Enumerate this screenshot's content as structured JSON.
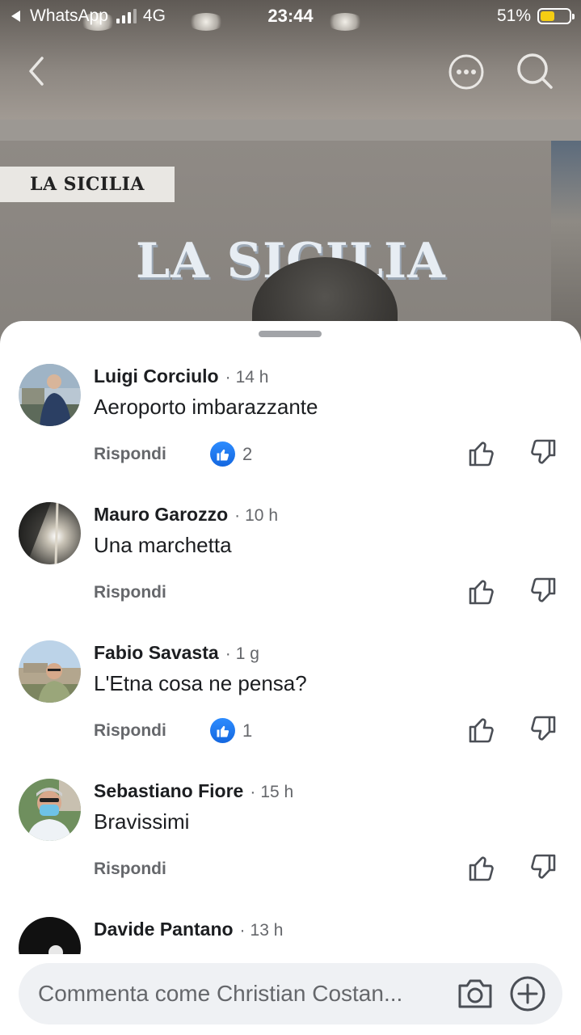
{
  "status_bar": {
    "back_app": "WhatsApp",
    "network": "4G",
    "time": "23:44",
    "battery_percent": "51%",
    "battery_level": 0.51,
    "battery_color": "#F4CD13"
  },
  "video": {
    "sign_small": "LA SICILIA",
    "sign_wall": "LA SICILIA"
  },
  "comments": [
    {
      "author": "Luigi Corciulo",
      "time": "14 h",
      "text": "Aeroporto imbarazzante",
      "reply_label": "Rispondi",
      "likes": "2"
    },
    {
      "author": "Mauro Garozzo",
      "time": "10 h",
      "text": "Una marchetta",
      "reply_label": "Rispondi",
      "likes": null
    },
    {
      "author": "Fabio Savasta",
      "time": "1 g",
      "text": "L'Etna cosa ne pensa?",
      "reply_label": "Rispondi",
      "likes": "1"
    },
    {
      "author": "Sebastiano Fiore",
      "time": "15 h",
      "text": "Bravissimi",
      "reply_label": "Rispondi",
      "likes": null
    },
    {
      "author": "Davide Pantano",
      "time": "13 h",
      "text": "",
      "reply_label": "",
      "likes": null
    }
  ],
  "composer": {
    "placeholder": "Commenta come Christian Costan..."
  },
  "icons": [
    "back-chevron-icon",
    "more-options-icon",
    "search-icon",
    "like-icon",
    "thumbs-up-icon",
    "thumbs-down-icon",
    "camera-icon",
    "plus-circle-icon"
  ],
  "colors": {
    "like_blue": "#1877F2",
    "secondary_text": "#65676B",
    "primary_text": "#1C1E21",
    "composer_bg": "#EFF1F4"
  }
}
